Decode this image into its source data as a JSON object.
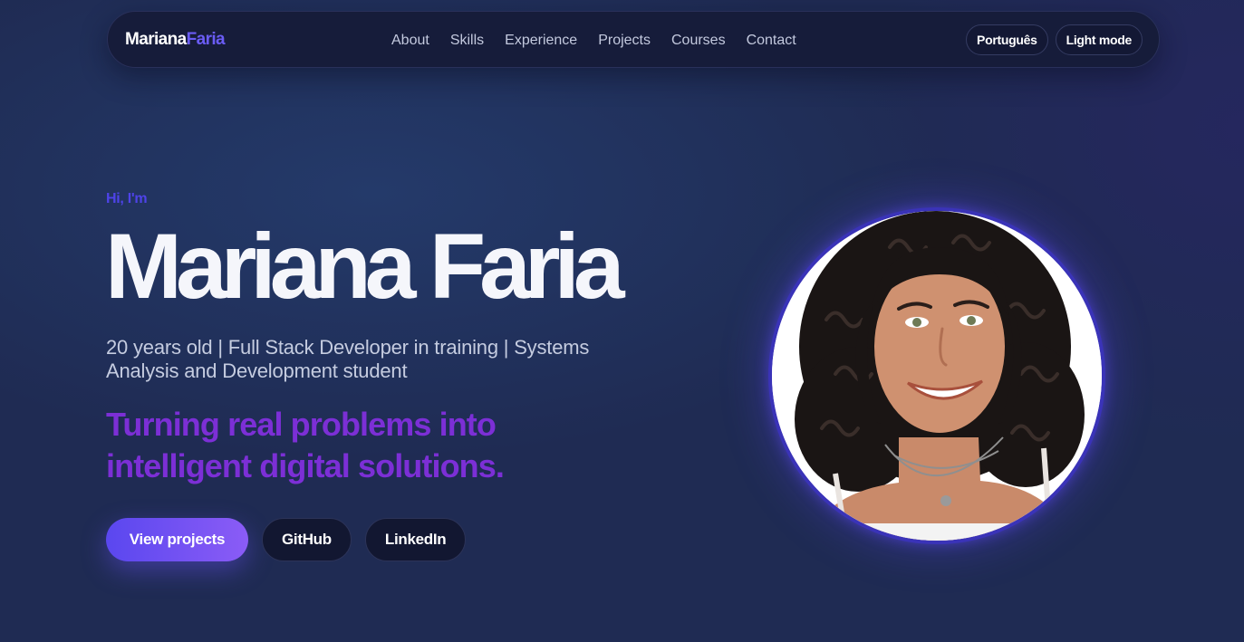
{
  "navbar": {
    "brand_first": "Mariana",
    "brand_last": "Faria",
    "links": [
      "About",
      "Skills",
      "Experience",
      "Projects",
      "Courses",
      "Contact"
    ],
    "language_button": "Português",
    "theme_button": "Light mode"
  },
  "hero": {
    "greeting": "Hi, I'm",
    "name": "Mariana Faria",
    "subtitle": "20 years old | Full Stack Developer in training | Systems Analysis and Development student",
    "tagline": "Turning real problems into intelligent digital solutions.",
    "buttons": {
      "primary": "View projects",
      "github": "GitHub",
      "linkedin": "LinkedIn"
    },
    "avatar_icon": "profile-photo"
  },
  "colors": {
    "background": "#1f2b53",
    "accent": "#6a5cf5",
    "tagline": "#7c2fd6",
    "primary_gradient_start": "#5a47ef",
    "primary_gradient_end": "#8b5cf6"
  }
}
